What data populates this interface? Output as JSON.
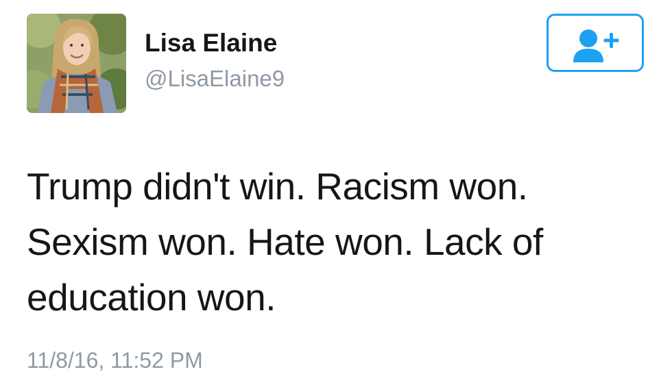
{
  "user": {
    "display_name": "Lisa Elaine",
    "handle": "@LisaElaine9",
    "avatar_icon": "profile-photo"
  },
  "follow_button": {
    "icon": "add-user-icon",
    "color": "#1da1f2"
  },
  "tweet": {
    "text_lines": [
      "Trump didn't win. Racism won.",
      "Sexism won. Hate won. Lack of",
      "education won."
    ],
    "timestamp": "11/8/16, 11:52 PM"
  },
  "colors": {
    "text": "#14171a",
    "muted": "#8f99a3",
    "accent": "#1da1f2",
    "background": "#ffffff"
  }
}
